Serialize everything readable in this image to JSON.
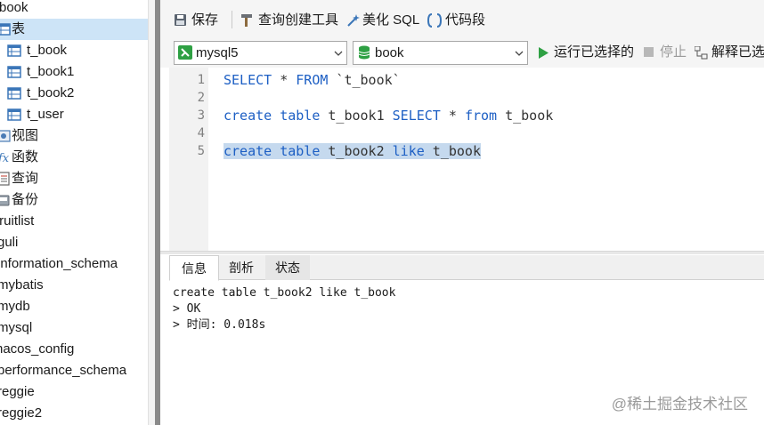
{
  "sidebar": {
    "db_root": "book",
    "nodes": [
      {
        "label": "表",
        "icon": "tables-folder-icon"
      },
      {
        "label": "t_book",
        "icon": "table-icon"
      },
      {
        "label": "t_book1",
        "icon": "table-icon"
      },
      {
        "label": "t_book2",
        "icon": "table-icon"
      },
      {
        "label": "t_user",
        "icon": "table-icon"
      },
      {
        "label": "视图",
        "icon": "views-folder-icon"
      },
      {
        "label": "函数",
        "icon": "functions-folder-icon"
      },
      {
        "label": "查询",
        "icon": "queries-folder-icon"
      },
      {
        "label": "备份",
        "icon": "backups-folder-icon"
      }
    ],
    "databases": [
      "fruitlist",
      "guli",
      "information_schema",
      "mybatis",
      "mydb",
      "mysql",
      "nacos_config",
      "performance_schema",
      "reggie",
      "reggie2"
    ]
  },
  "toolbar": {
    "save": "保存",
    "query_builder": "查询创建工具",
    "beautify": "美化 SQL",
    "snippet": "代码段"
  },
  "selection_bar": {
    "connection": "mysql5",
    "database": "book",
    "run_selected": "运行已选择的",
    "stop": "停止",
    "explain": "解释已选"
  },
  "editor": {
    "line_numbers": [
      "1",
      "2",
      "3",
      "4",
      "5"
    ],
    "line1": {
      "kw1": "SELECT",
      "rest1": " * ",
      "kw2": "FROM",
      "rest2": " `t_book`"
    },
    "line3": {
      "kw1": "create",
      "s1": " ",
      "kw2": "table",
      "s2": " t_book1 ",
      "kw3": "SELECT",
      "s3": " * ",
      "kw4": "from",
      "s4": " t_book"
    },
    "line5": {
      "kw1": "create",
      "s1": " ",
      "kw2": "table",
      "s2": " t_book2 ",
      "kw3": "like",
      "s3": " t_book"
    }
  },
  "result_tabs": [
    "信息",
    "剖析",
    "状态"
  ],
  "messages": [
    "create table t_book2 like t_book",
    "> OK",
    "> 时间: 0.018s"
  ],
  "watermark": "@稀土掘金技术社区",
  "colors": {
    "keyword": "#1d5fc4",
    "selection": "#c5d9ee",
    "run_green": "#2ea043"
  }
}
